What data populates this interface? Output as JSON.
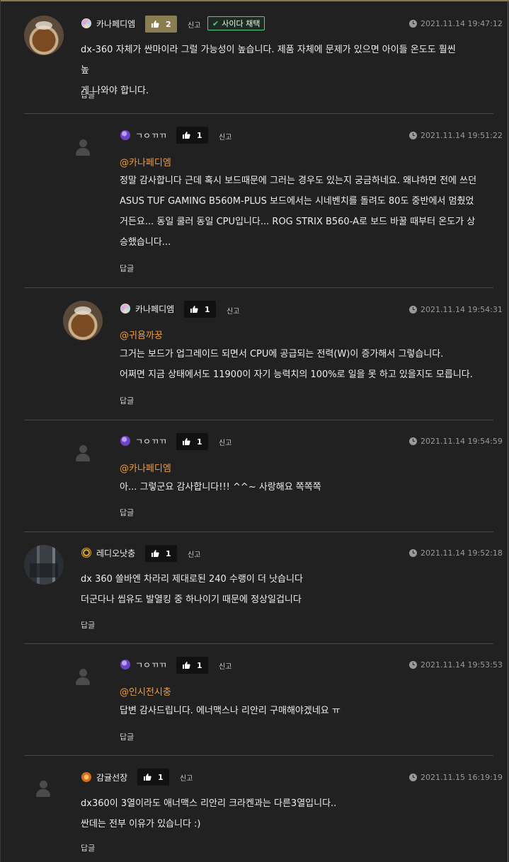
{
  "comments": [
    {
      "nick": "카나페디엠",
      "likes": "2",
      "report": "신고",
      "adopted": "사이다 채택",
      "time": "2021.11.14 19:47:12",
      "mention": "",
      "lines": [
        "dx-360 자체가 싼마이라 그럴 가능성이 높습니다. 제품 자체에 문제가 있으면 아이들 온도도 훨씬 높",
        "게 나와야 합니다."
      ],
      "reply": "답글"
    },
    {
      "nick": "ㄱㅇㄲㄲ",
      "likes": "1",
      "report": "신고",
      "time": "2021.11.14 19:51:22",
      "mention": "@카나페디엠",
      "lines": [
        "정말 감사합니다 근데 혹시 보드때문에 그러는 경우도 있는지 궁금하네요. 왜냐하면 전에 쓰던",
        "ASUS TUF GAMING B560M-PLUS 보드에서는 시네벤치를 돌려도 80도 중반에서 멈췄었",
        "거든요... 동일 쿨러 동일 CPU입니다... ROG STRIX B560-A로 보드 바꿀 때부터 온도가 상",
        "승했습니다..."
      ],
      "reply": "답글"
    },
    {
      "nick": "카나페디엠",
      "likes": "1",
      "report": "신고",
      "time": "2021.11.14 19:54:31",
      "mention": "@귀욤까꿍",
      "lines": [
        "그거는 보드가 업그레이드 되면서 CPU에 공급되는 전력(W)이 증가해서 그렇습니다.",
        "어쩌면 지금 상태에서도 11900이 자기 능력치의 100%로 일을 못 하고 있을지도 모릅니다."
      ],
      "reply": "답글"
    },
    {
      "nick": "ㄱㅇㄲㄲ",
      "likes": "1",
      "report": "신고",
      "time": "2021.11.14 19:54:59",
      "mention": "@카나페디엠",
      "lines": [
        "아... 그렇군요 감사합니다!!! ^^~ 사랑해요 쪽쪽쪽"
      ],
      "reply": "답글"
    },
    {
      "nick": "레디오낫충",
      "likes": "1",
      "report": "신고",
      "time": "2021.11.14 19:52:18",
      "mention": "",
      "lines": [
        "dx 360 쓸바엔 차라리 제대로된 240 수랭이 더 낫습니다",
        "더군다나 씹유도 발열킹 중 하나이기 때문에 정상일겁니다"
      ],
      "reply": "답글"
    },
    {
      "nick": "ㄱㅇㄲㄲ",
      "likes": "1",
      "report": "신고",
      "time": "2021.11.14 19:53:53",
      "mention": "@인시전시충",
      "lines": [
        "답변 감사드립니다. 에너맥스나 리안리 구매해야겠네요 ㅠ"
      ],
      "reply": "답글"
    },
    {
      "nick": "감귤선장",
      "likes": "1",
      "report": "신고",
      "time": "2021.11.15 16:19:19",
      "mention": "",
      "lines": [
        "dx360이 3열이라도 애너맥스 리안리 크라켄과는 다른3열입니다..",
        "싼데는 전부 이유가 있습니다 :)"
      ],
      "reply": "답글"
    }
  ],
  "icons": {
    "thumbs_up": "thumbs-up-icon",
    "clock": "clock-icon",
    "check": "check-icon",
    "user_placeholder": "user-icon"
  },
  "colors": {
    "background": "#212121",
    "mention": "#f29a3a",
    "adopted_border": "#4fd08a",
    "like_highlight": "#8b7d52"
  }
}
